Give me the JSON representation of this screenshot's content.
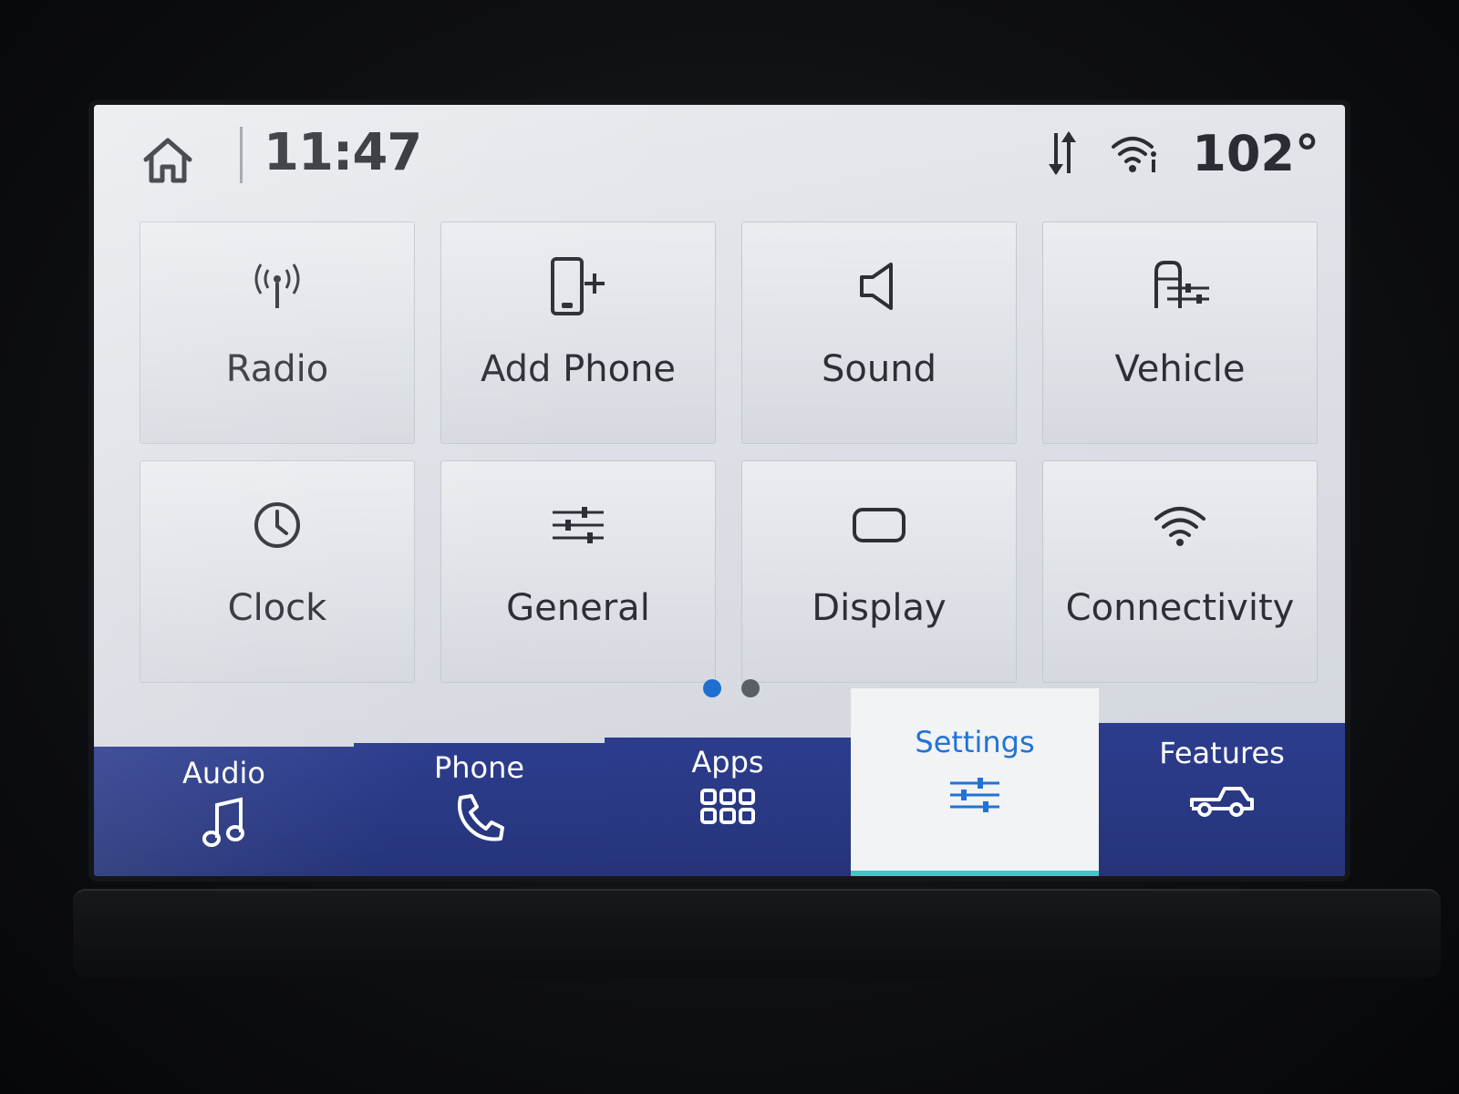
{
  "status_bar": {
    "time": "11:47",
    "temperature": "102°",
    "icons": [
      "home-icon",
      "data-transfer-icon",
      "wifi-info-icon"
    ]
  },
  "settings_tiles": [
    {
      "label": "Radio",
      "icon": "radio-antenna-icon"
    },
    {
      "label": "Add Phone",
      "icon": "add-phone-icon"
    },
    {
      "label": "Sound",
      "icon": "speaker-icon"
    },
    {
      "label": "Vehicle",
      "icon": "vehicle-settings-icon"
    },
    {
      "label": "Clock",
      "icon": "clock-icon"
    },
    {
      "label": "General",
      "icon": "sliders-icon"
    },
    {
      "label": "Display",
      "icon": "display-icon"
    },
    {
      "label": "Connectivity",
      "icon": "wifi-icon"
    }
  ],
  "pager": {
    "total": 2,
    "current": 1
  },
  "nav": [
    {
      "label": "Audio",
      "icon": "music-note-icon"
    },
    {
      "label": "Phone",
      "icon": "phone-handset-icon"
    },
    {
      "label": "Apps",
      "icon": "apps-grid-icon"
    },
    {
      "label": "Settings",
      "icon": "settings-sliders-icon",
      "active": true
    },
    {
      "label": "Features",
      "icon": "truck-icon"
    }
  ],
  "colors": {
    "nav_background": "#2a3a87",
    "active_accent": "#2273d6",
    "active_underline": "#3ec7c7",
    "pager_active": "#1f6fd0"
  }
}
